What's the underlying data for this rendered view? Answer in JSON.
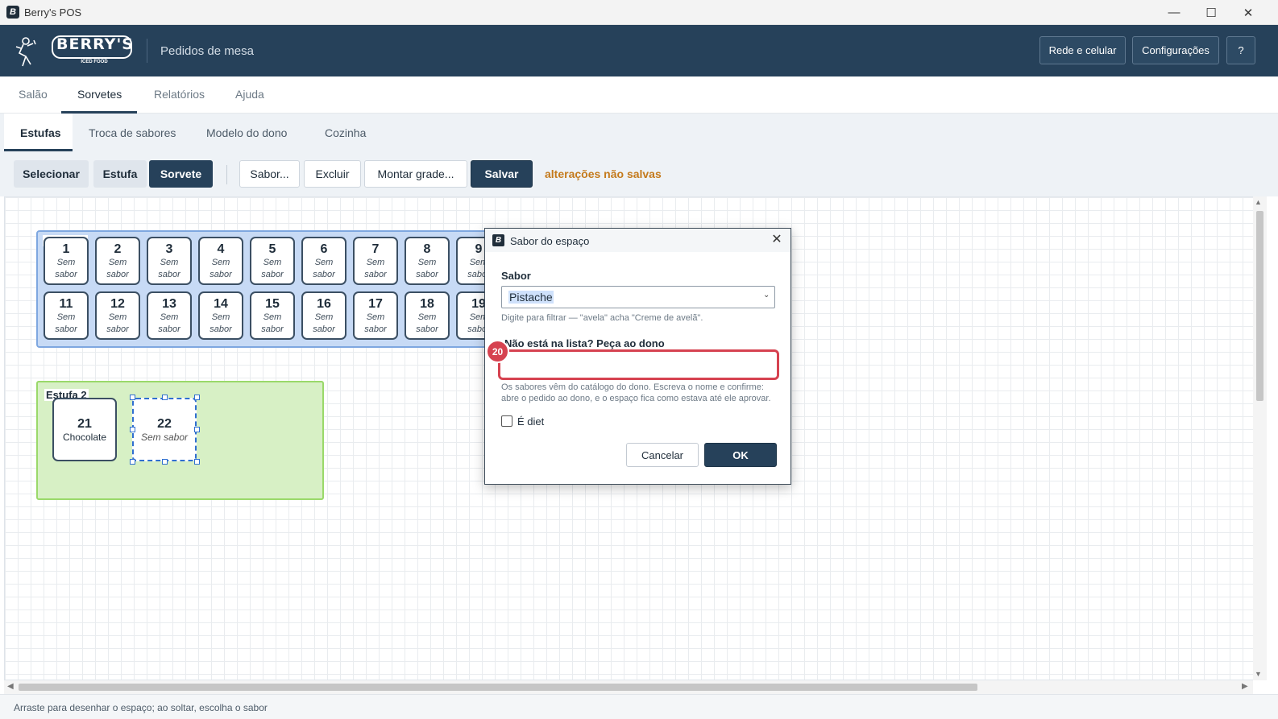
{
  "window": {
    "title": "Berry's POS"
  },
  "header": {
    "logo_text": "BERRY'S",
    "logo_tagline": "ICED FOOD",
    "subtitle": "Pedidos de mesa",
    "buttons": {
      "network": "Rede e celular",
      "settings": "Configurações",
      "help": "?"
    }
  },
  "main_tabs": [
    "Salão",
    "Sorvetes",
    "Relatórios",
    "Ajuda"
  ],
  "sub_tabs": [
    "Estufas",
    "Troca de sabores",
    "Modelo do dono",
    "Cozinha"
  ],
  "toolbar": {
    "mode_select": "Selecionar",
    "mode_estufa": "Estufa",
    "mode_sorvete": "Sorvete",
    "flavor": "Sabor...",
    "delete": "Excluir",
    "grid": "Montar grade...",
    "save": "Salvar",
    "unsaved": "alterações não salvas"
  },
  "estufa1": {
    "slots": [
      {
        "num": "1",
        "line1": "Sem",
        "line2": "sabor"
      },
      {
        "num": "2",
        "line1": "Sem",
        "line2": "sabor"
      },
      {
        "num": "3",
        "line1": "Sem",
        "line2": "sabor"
      },
      {
        "num": "4",
        "line1": "Sem",
        "line2": "sabor"
      },
      {
        "num": "5",
        "line1": "Sem",
        "line2": "sabor"
      },
      {
        "num": "6",
        "line1": "Sem",
        "line2": "sabor"
      },
      {
        "num": "7",
        "line1": "Sem",
        "line2": "sabor"
      },
      {
        "num": "8",
        "line1": "Sem",
        "line2": "sabor"
      },
      {
        "num": "9",
        "line1": "Sem",
        "line2": "sabor"
      },
      {
        "num": "11",
        "line1": "Sem",
        "line2": "sabor"
      },
      {
        "num": "12",
        "line1": "Sem",
        "line2": "sabor"
      },
      {
        "num": "13",
        "line1": "Sem",
        "line2": "sabor"
      },
      {
        "num": "14",
        "line1": "Sem",
        "line2": "sabor"
      },
      {
        "num": "15",
        "line1": "Sem",
        "line2": "sabor"
      },
      {
        "num": "16",
        "line1": "Sem",
        "line2": "sabor"
      },
      {
        "num": "17",
        "line1": "Sem",
        "line2": "sabor"
      },
      {
        "num": "18",
        "line1": "Sem",
        "line2": "sabor"
      },
      {
        "num": "19",
        "line1": "Sem",
        "line2": "sabor"
      }
    ]
  },
  "estufa2": {
    "label": "Estufa 2",
    "slots": [
      {
        "num": "21",
        "flavor": "Chocolate"
      },
      {
        "num": "22",
        "flavor": "Sem sabor"
      }
    ]
  },
  "dialog": {
    "title": "Sabor do espaço",
    "flavor_label": "Sabor",
    "flavor_value": "Pistache",
    "filter_hint": "Digite para filtrar — \"avela\" acha \"Creme de avelã\".",
    "ask_label": "Não está na lista? Peça ao dono",
    "ask_value": "",
    "ask_hint_1": "Os sabores vêm do catálogo do dono. Escreva o nome e confirme:",
    "ask_hint_2": "abre o pedido ao dono, e o espaço fica como estava até ele aprovar.",
    "diet_label": "É diet",
    "cancel": "Cancelar",
    "ok": "OK"
  },
  "badge": "20",
  "status": "Arraste para desenhar o espaço; ao soltar, escolha o sabor",
  "colors": {
    "header": "#26415a",
    "accent": "#d64250",
    "warning": "#c47a1c",
    "estufa1": "#c7daf5",
    "estufa2": "#d7f0c5"
  }
}
